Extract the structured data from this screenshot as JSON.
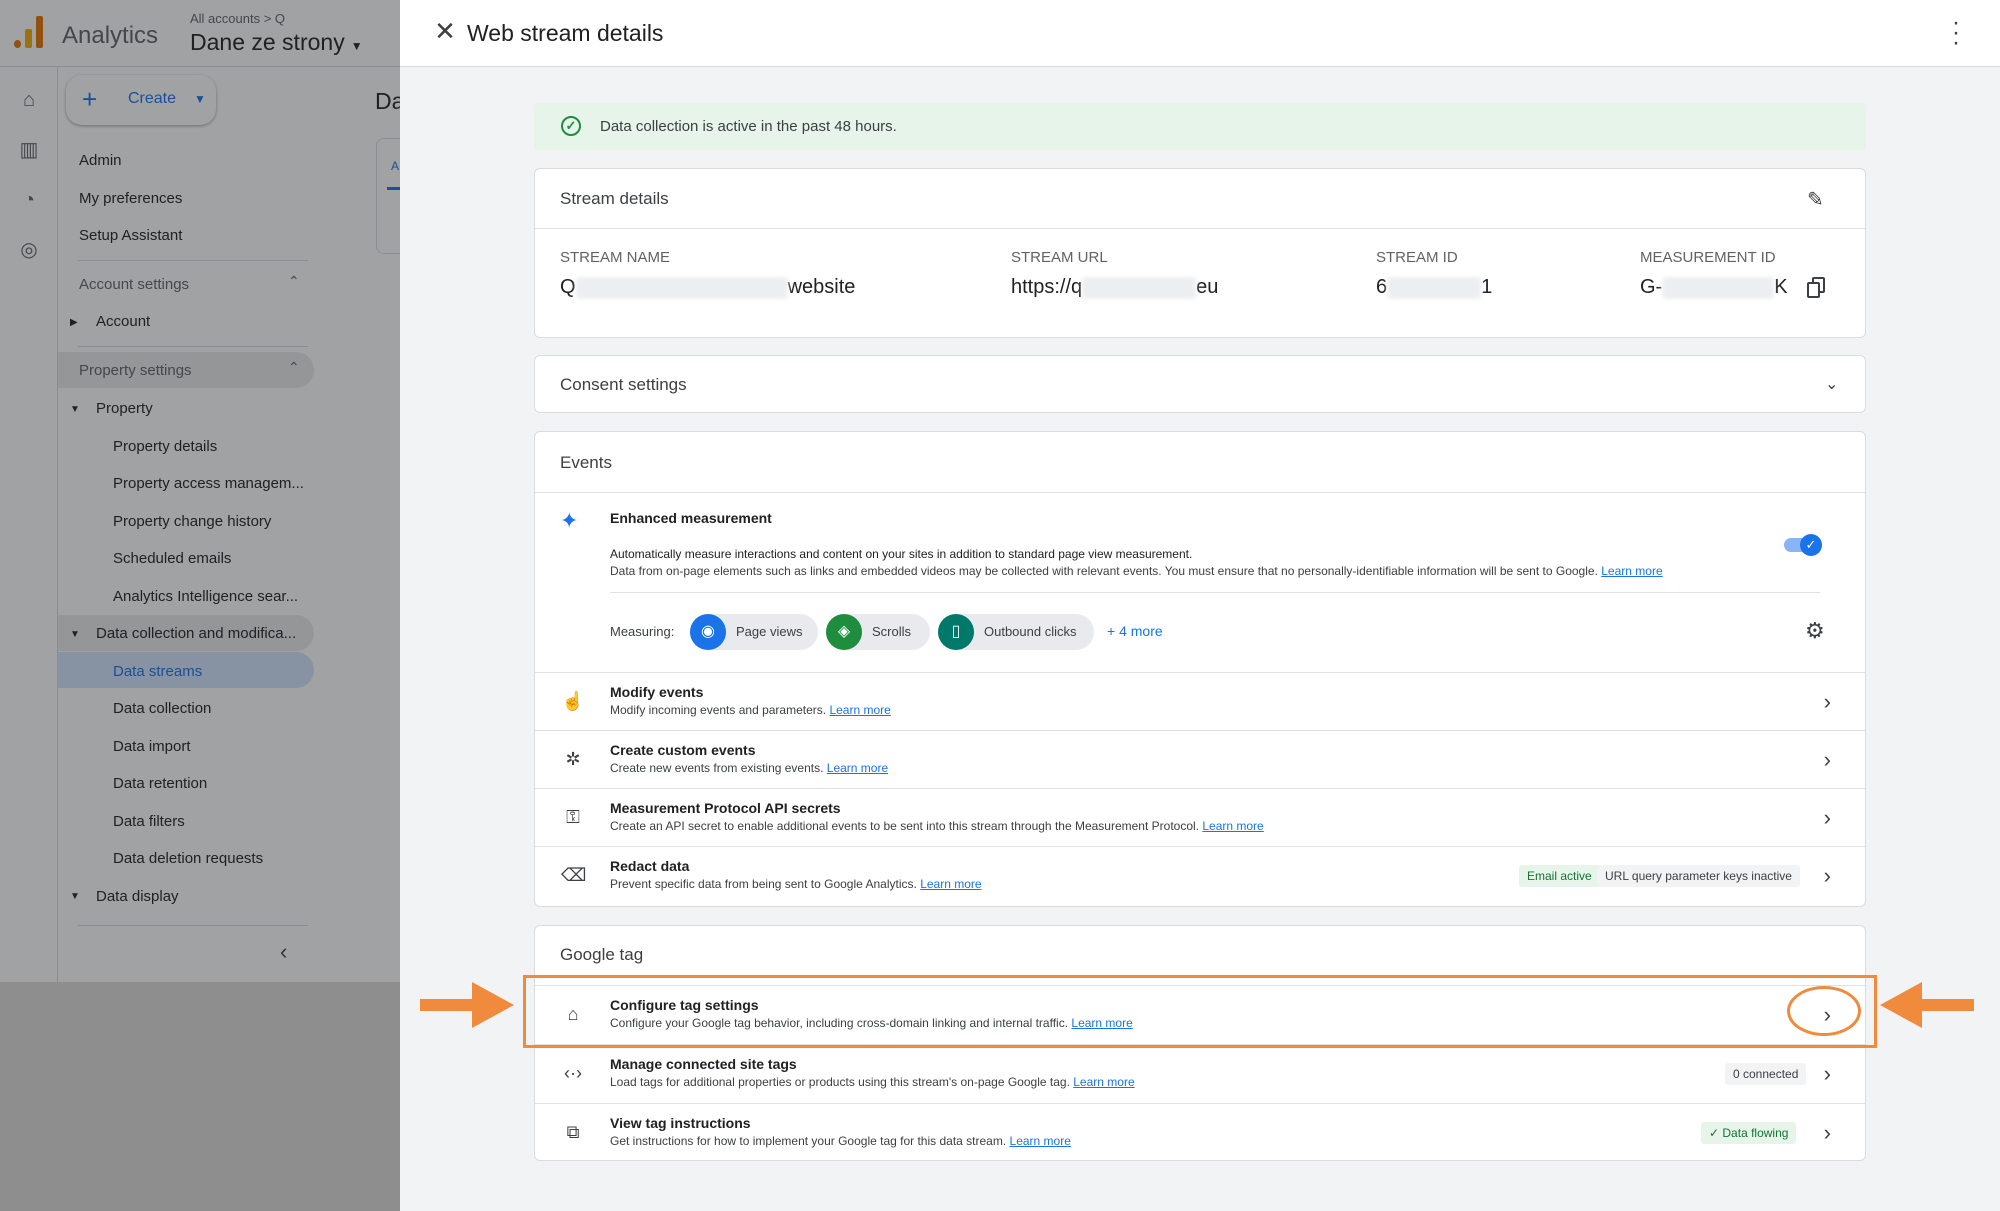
{
  "app": {
    "name": "Analytics",
    "breadcrumb_small": "All accounts > Q",
    "property_name": "Dane ze strony",
    "main_title_fragment": "Da",
    "main_tab_fragment": "A"
  },
  "sidebar": {
    "create_label": "Create",
    "top_items": [
      "Admin",
      "My preferences",
      "Setup Assistant"
    ],
    "account_settings": {
      "label": "Account settings",
      "items": [
        "Account"
      ]
    },
    "property_settings": {
      "label": "Property settings",
      "property": {
        "label": "Property",
        "items": [
          "Property details",
          "Property access managem...",
          "Property change history",
          "Scheduled emails",
          "Analytics Intelligence sear..."
        ]
      },
      "data_collection": {
        "label": "Data collection and modifica...",
        "items": [
          "Data streams",
          "Data collection",
          "Data import",
          "Data retention",
          "Data filters",
          "Data deletion requests"
        ]
      },
      "data_display": {
        "label": "Data display"
      }
    }
  },
  "panel": {
    "title": "Web stream details",
    "banner": "Data collection is active in the past 48 hours.",
    "stream_details": {
      "heading": "Stream details",
      "fields": [
        {
          "label": "STREAM NAME",
          "prefix": "Q",
          "suffix": "website"
        },
        {
          "label": "STREAM URL",
          "prefix": "https://q",
          "suffix": "eu"
        },
        {
          "label": "STREAM ID",
          "prefix": "6",
          "suffix": "1"
        },
        {
          "label": "MEASUREMENT ID",
          "prefix": "G-",
          "suffix": "K"
        }
      ]
    },
    "consent": {
      "heading": "Consent settings"
    },
    "events": {
      "heading": "Events",
      "enhanced": {
        "title": "Enhanced measurement",
        "desc1": "Automatically measure interactions and content on your sites in addition to standard page view measurement.",
        "desc2": "Data from on-page elements such as links and embedded videos may be collected with relevant events. You must ensure that no personally-identifiable information will be sent to Google.",
        "learn_more": "Learn more",
        "measuring_label": "Measuring:",
        "chips": [
          "Page views",
          "Scrolls",
          "Outbound clicks"
        ],
        "more": "+ 4 more",
        "enabled": true
      },
      "rows": [
        {
          "title": "Modify events",
          "desc": "Modify incoming events and parameters.",
          "link": "Learn more"
        },
        {
          "title": "Create custom events",
          "desc": "Create new events from existing events.",
          "link": "Learn more"
        },
        {
          "title": "Measurement Protocol API secrets",
          "desc": "Create an API secret to enable additional events to be sent into this stream through the Measurement Protocol.",
          "link": "Learn more"
        },
        {
          "title": "Redact data",
          "desc": "Prevent specific data from being sent to Google Analytics.",
          "link": "Learn more",
          "chip_active": "Email active",
          "chip_inactive": "URL query parameter keys inactive"
        }
      ]
    },
    "google_tag": {
      "heading": "Google tag",
      "rows": [
        {
          "title": "Configure tag settings",
          "desc": "Configure your Google tag behavior, including cross-domain linking and internal traffic.",
          "link": "Learn more"
        },
        {
          "title": "Manage connected site tags",
          "desc": "Load tags for additional properties or products using this stream's on-page Google tag.",
          "link": "Learn more",
          "status": "0 connected"
        },
        {
          "title": "View tag instructions",
          "desc": "Get instructions for how to implement your Google tag for this data stream.",
          "link": "Learn more",
          "status": "Data flowing"
        }
      ]
    }
  },
  "colors": {
    "accent": "#1a73e8",
    "highlight": "#f08a3c",
    "success_bg": "#e6f4ea",
    "success": "#1e8e3e"
  }
}
